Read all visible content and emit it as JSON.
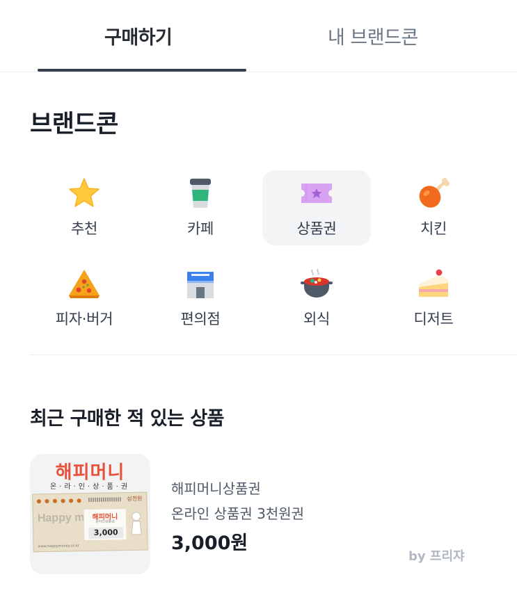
{
  "tabs": {
    "buy": "구매하기",
    "mine": "내 브랜드콘"
  },
  "brandcon": {
    "title": "브랜드콘",
    "categories": [
      {
        "label": "추천",
        "icon": "star-icon"
      },
      {
        "label": "카페",
        "icon": "coffee-cup-icon"
      },
      {
        "label": "상품권",
        "icon": "ticket-icon",
        "selected": true
      },
      {
        "label": "치킨",
        "icon": "chicken-leg-icon"
      },
      {
        "label": "피자·버거",
        "icon": "pizza-icon"
      },
      {
        "label": "편의점",
        "icon": "convenience-store-icon"
      },
      {
        "label": "외식",
        "icon": "hot-pot-icon"
      },
      {
        "label": "디저트",
        "icon": "cake-icon"
      }
    ]
  },
  "recent": {
    "title": "최근 구매한 적 있는 상품",
    "product": {
      "brand": "해피머니상품권",
      "name": "온라인 상품권 3천원권",
      "price": "3,000원",
      "image": {
        "title": "해피머니",
        "subtitle": "온·라·인·상·품·권",
        "ticket_title": "해피머니",
        "ticket_subtitle": "온라인상품권",
        "ticket_amount": "3,000",
        "ticket_amount_label": "삼천원",
        "happy_text": "Happy money",
        "url_text": "www.happymoney.co.kr"
      }
    }
  },
  "footer": {
    "by": "by 프리쟈"
  },
  "colors": {
    "tab_active": "#262b33",
    "tab_inactive": "#6b7684",
    "indicator": "#333d4b",
    "selected_bg": "#f2f4f6",
    "brand_red": "#e8503a"
  }
}
